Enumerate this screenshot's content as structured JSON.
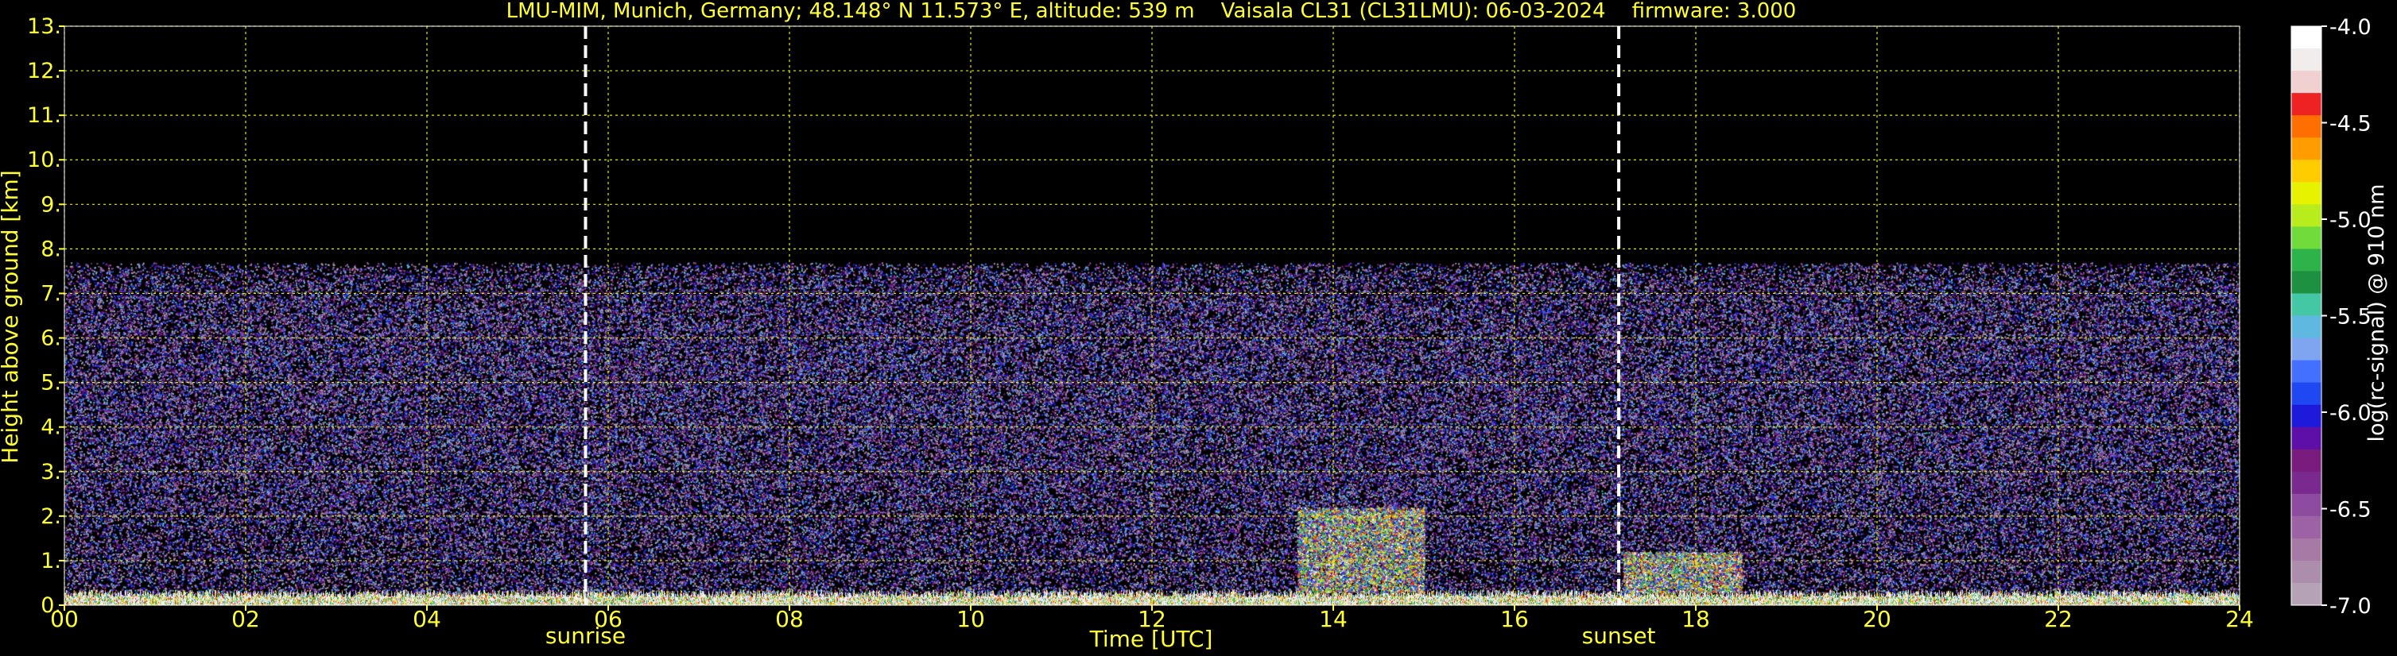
{
  "chart_data": {
    "type": "heatmap",
    "title": "LMU-MIM, Munich, Germany; 48.148° N 11.573° E, altitude: 539 m    Vaisala CL31 (CL31LMU): 06-03-2024    firmware: 3.000",
    "xlabel": "Time [UTC]",
    "ylabel": "Height above ground [km]",
    "xlim": [
      0,
      24
    ],
    "ylim": [
      0,
      13
    ],
    "x_ticks": [
      0,
      2,
      4,
      6,
      8,
      10,
      12,
      14,
      16,
      18,
      20,
      22,
      24
    ],
    "x_tick_labels": [
      "00",
      "02",
      "04",
      "06",
      "08",
      "10",
      "12",
      "14",
      "16",
      "18",
      "20",
      "22",
      "24"
    ],
    "y_ticks": [
      0,
      1,
      2,
      3,
      4,
      5,
      6,
      7,
      8,
      9,
      10,
      11,
      12,
      13
    ],
    "y_tick_labels": [
      "0.",
      "1.",
      "2.",
      "3.",
      "4.",
      "5.",
      "6.",
      "7.",
      "8.",
      "9.",
      "10.",
      "11.",
      "12.",
      "13."
    ],
    "grid": true,
    "markers": [
      {
        "label": "sunrise",
        "x": 5.75
      },
      {
        "label": "sunset",
        "x": 17.15
      }
    ],
    "colorbar": {
      "label": "log(rc-signal) @ 910 nm",
      "range": [
        -7.0,
        -4.0
      ],
      "tick_values": [
        -4.0,
        -4.5,
        -5.0,
        -5.5,
        -6.0,
        -6.5,
        -7.0
      ],
      "tick_labels": [
        "-4.0",
        "-4.5",
        "-5.0",
        "-5.5",
        "-6.0",
        "-6.5",
        "-7.0"
      ],
      "colors": [
        "#ffffff",
        "#f2eded",
        "#f0d0d0",
        "#ee2222",
        "#ff6f00",
        "#ff9d00",
        "#ffcc00",
        "#e6f200",
        "#b8ec1c",
        "#6fdc3c",
        "#2db34a",
        "#1e9040",
        "#44c7a4",
        "#5fb8e0",
        "#7fa4f0",
        "#4470ff",
        "#1f48f2",
        "#1d1adc",
        "#5d0fa8",
        "#7a1c7e",
        "#7a2a8e",
        "#8e4ca0",
        "#9c62a4",
        "#a77aa6",
        "#ac8eac",
        "#b5a2b6"
      ]
    },
    "features": [
      {
        "name": "noise layer",
        "x_range": [
          0,
          24
        ],
        "y_range": [
          0.2,
          7.7
        ]
      },
      {
        "name": "near-surface aerosol layer",
        "x_range": [
          0,
          24
        ],
        "y_range": [
          0,
          0.35
        ]
      },
      {
        "name": "elevated layer",
        "x_range": [
          13.6,
          15.0
        ],
        "y_range": [
          0.3,
          2.2
        ]
      },
      {
        "name": "elevated layer",
        "x_range": [
          17.2,
          18.5
        ],
        "y_range": [
          0.3,
          1.2
        ]
      }
    ]
  }
}
